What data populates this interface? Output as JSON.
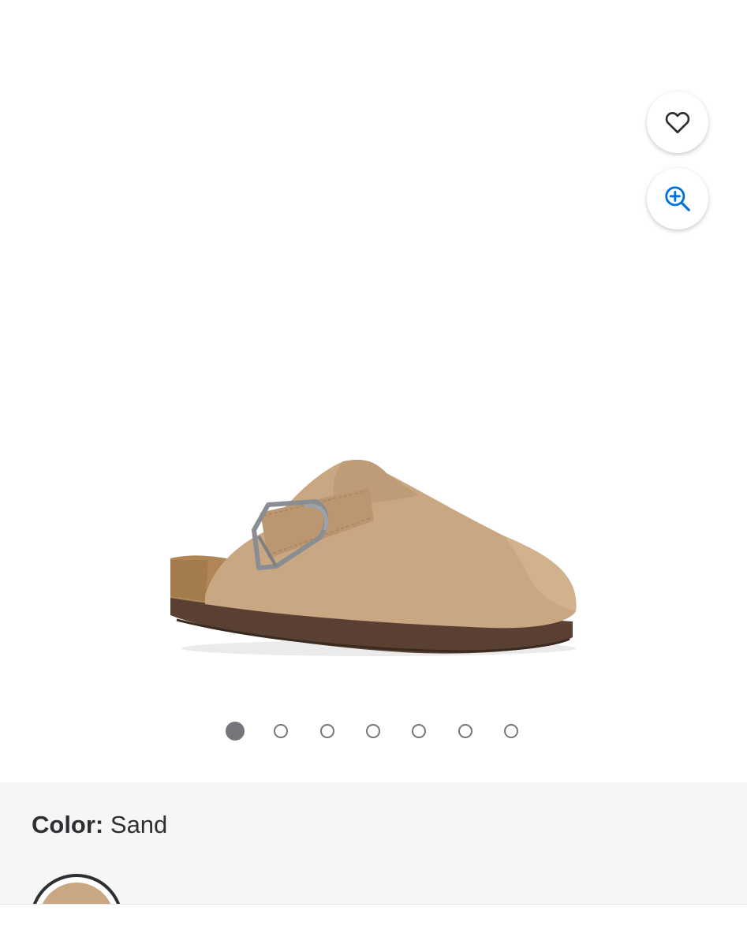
{
  "gallery": {
    "favorite_icon": "heart-icon",
    "zoom_icon": "zoom-in-icon",
    "image_count": 7,
    "active_index": 0
  },
  "product": {
    "color_label": "Color:",
    "color_value": "Sand",
    "swatch_color": "#c9a783"
  },
  "colors": {
    "accent": "#0071dc",
    "border_blue": "#2b4e9a",
    "dot": "#74767c",
    "panel_bg": "#f6f6f7"
  }
}
